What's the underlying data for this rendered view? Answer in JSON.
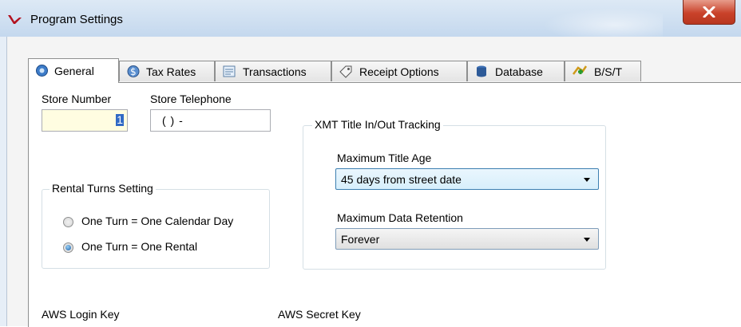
{
  "window": {
    "title": "Program Settings",
    "close_icon": "close-x-icon"
  },
  "tabs": [
    {
      "label": "General",
      "icon": "gear-globe-icon",
      "active": true
    },
    {
      "label": "Tax Rates",
      "icon": "dollar-coin-icon",
      "active": false
    },
    {
      "label": "Transactions",
      "icon": "document-list-icon",
      "active": false
    },
    {
      "label": "Receipt Options",
      "icon": "receipt-tag-icon",
      "active": false
    },
    {
      "label": "Database",
      "icon": "database-icon",
      "active": false
    },
    {
      "label": "B/S/T",
      "icon": "bst-icon",
      "active": false
    }
  ],
  "general": {
    "store_number_label": "Store Number",
    "store_number_value": "1",
    "store_telephone_label": "Store Telephone",
    "store_telephone_value": "(   )     -",
    "rental_group": {
      "legend": "Rental Turns Setting",
      "options": [
        {
          "label": "One Turn = One Calendar Day",
          "selected": false
        },
        {
          "label": "One Turn = One Rental",
          "selected": true
        }
      ]
    },
    "xmt_group": {
      "legend": "XMT Title In/Out Tracking",
      "max_title_age_label": "Maximum Title Age",
      "max_title_age_value": "45 days from street date",
      "max_data_retention_label": "Maximum Data Retention",
      "max_data_retention_value": "Forever"
    },
    "aws_login_key_label": "AWS Login Key",
    "aws_secret_key_label": "AWS Secret Key"
  },
  "colors": {
    "titlebar": "#c4d8ee",
    "close_button": "#c9422a",
    "radio_selected": "#1a5fa8",
    "focus_border": "#3c7fb1"
  }
}
